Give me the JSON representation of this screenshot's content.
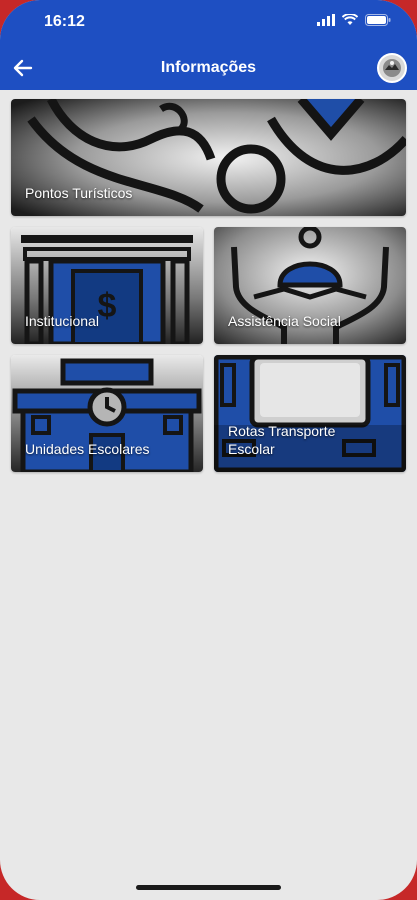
{
  "status": {
    "time": "16:12"
  },
  "header": {
    "title": "Informações"
  },
  "cards": [
    {
      "label": "Pontos Turísticos"
    },
    {
      "label": "Institucional"
    },
    {
      "label": "Assistência Social"
    },
    {
      "label": "Unidades Escolares"
    },
    {
      "label_line1": "Rotas Transporte",
      "label_line2": "Escolar"
    }
  ],
  "colors": {
    "header": "#1e4fc2",
    "background": "#e8e8e8",
    "accent": "#1f4ea8"
  },
  "icons": [
    "back-arrow-icon",
    "signal-icon",
    "wifi-icon",
    "battery-icon",
    "avatar"
  ]
}
